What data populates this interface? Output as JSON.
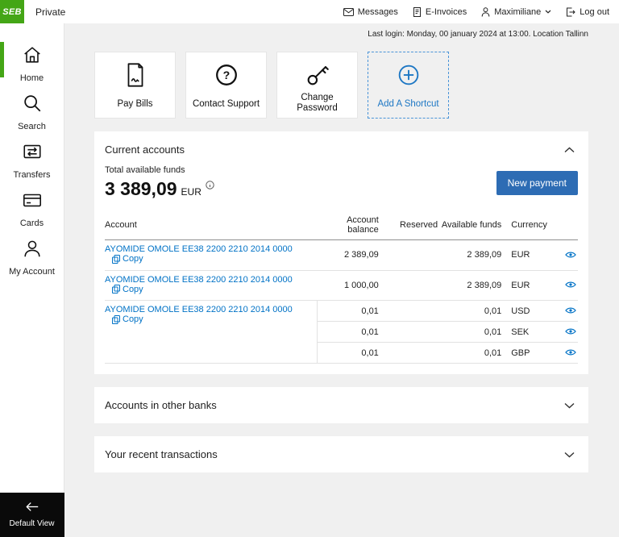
{
  "topbar": {
    "logo": "SEB",
    "segment": "Private",
    "actions": [
      {
        "label": "Messages",
        "icon": "envelope-icon"
      },
      {
        "label": "E-Invoices",
        "icon": "document-icon"
      },
      {
        "label": "Maximiliane",
        "icon": "person-icon"
      },
      {
        "label": "Log out",
        "icon": "logout-icon"
      }
    ]
  },
  "sidebar": {
    "items": [
      {
        "label": "Home",
        "icon": "home-icon",
        "active": true
      },
      {
        "label": "Search",
        "icon": "search-icon",
        "active": false
      },
      {
        "label": "Transfers",
        "icon": "transfers-icon",
        "active": false
      },
      {
        "label": "Cards",
        "icon": "cards-icon",
        "active": false
      },
      {
        "label": "My Account",
        "icon": "person-icon",
        "active": false
      }
    ],
    "footer_label": "Default View"
  },
  "main": {
    "last_login": "Last login: Monday, 00 january 2024 at 13:00. Location Tallinn",
    "shortcuts": [
      {
        "label": "Pay  Bills",
        "icon": "bill-icon"
      },
      {
        "label": "Contact Support",
        "icon": "question-circle-icon"
      },
      {
        "label": "Change Password",
        "icon": "key-icon"
      },
      {
        "label": "Add A Shortcut",
        "icon": "plus-circle-icon"
      }
    ],
    "current_accounts": {
      "title": "Current accounts",
      "total_label": "Total available funds",
      "total_amount": "3 389,09",
      "total_currency": "EUR",
      "new_payment_label": "New payment",
      "copy_label": "Copy",
      "table": {
        "headers": {
          "account": "Account",
          "balance": "Account balance",
          "reserved": "Reserved",
          "available": "Available funds",
          "currency": "Currency"
        },
        "rows": [
          {
            "account": "AYOMIDE OMOLE EE38 2200 2210 2014 0000",
            "balance": "2 389,09",
            "reserved": "",
            "available": "2 389,09",
            "currency": "EUR"
          },
          {
            "account": "AYOMIDE OMOLE EE38 2200 2210 2014 0000",
            "balance": "1 000,00",
            "reserved": "",
            "available": "2 389,09",
            "currency": "EUR"
          },
          {
            "account": "AYOMIDE OMOLE EE38 2200 2210 2014 0000",
            "balance": "0,01",
            "reserved": "",
            "available": "0,01",
            "currency": "USD"
          },
          {
            "account": "",
            "balance": "0,01",
            "reserved": "",
            "available": "0,01",
            "currency": "SEK"
          },
          {
            "account": "",
            "balance": "0,01",
            "reserved": "",
            "available": "0,01",
            "currency": "GBP"
          }
        ]
      }
    },
    "panels": [
      {
        "title": "Accounts in other banks"
      },
      {
        "title": "Your recent transactions"
      }
    ]
  },
  "colors": {
    "brand_green": "#44a616",
    "link_blue": "#0072c6",
    "button_blue": "#2d6cb4",
    "shortcut_blue": "#1d77c4",
    "page_background": "#f0f0f0"
  }
}
